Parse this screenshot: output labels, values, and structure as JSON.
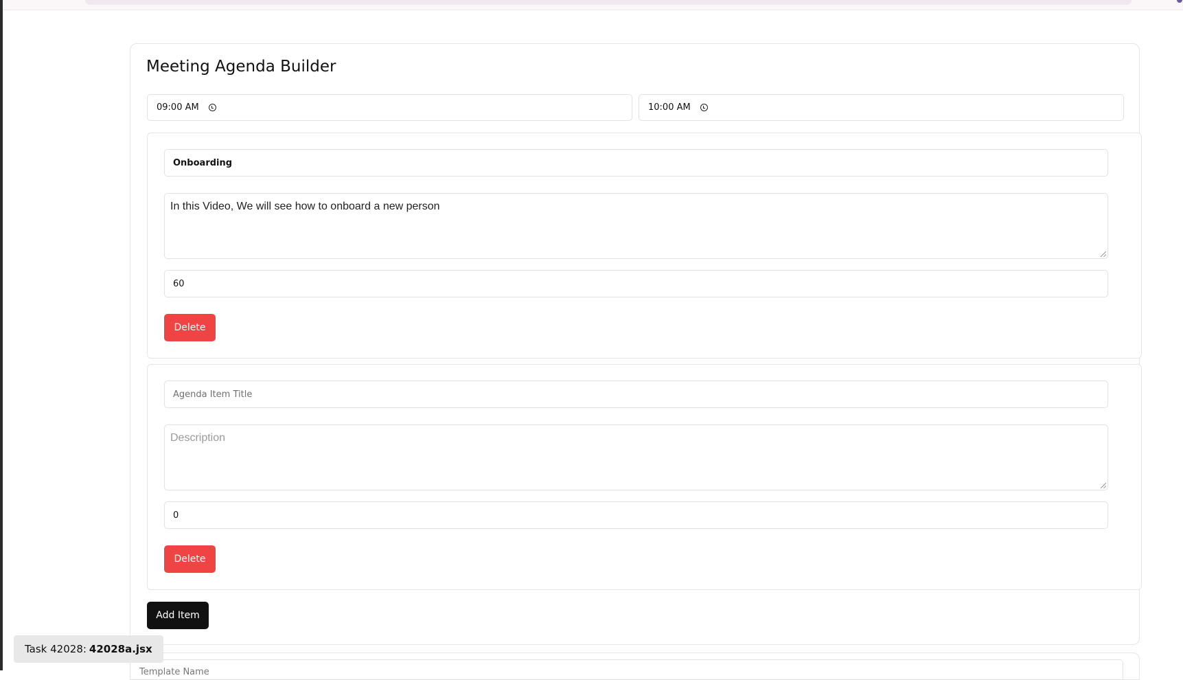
{
  "page": {
    "title": "Meeting Agenda Builder"
  },
  "times": {
    "start": "09:00 AM",
    "end": "10:00 AM"
  },
  "agenda_items": [
    {
      "title_value": "Onboarding",
      "title_placeholder": "Agenda Item Title",
      "description_value": "In this Video, We will see how to onboard a new person",
      "description_placeholder": "Description",
      "duration_value": "60",
      "delete_label": "Delete"
    },
    {
      "title_value": "",
      "title_placeholder": "Agenda Item Title",
      "description_value": "",
      "description_placeholder": "Description",
      "duration_value": "0",
      "delete_label": "Delete"
    }
  ],
  "actions": {
    "add_item_label": "Add Item"
  },
  "template": {
    "name_placeholder": "Template Name"
  },
  "task_label": {
    "prefix": "Task 42028:",
    "file": "42028a.jsx"
  },
  "colors": {
    "delete_button": "#ef4444",
    "add_button": "#111111"
  },
  "icons": {
    "time_field": "clock-icon"
  }
}
